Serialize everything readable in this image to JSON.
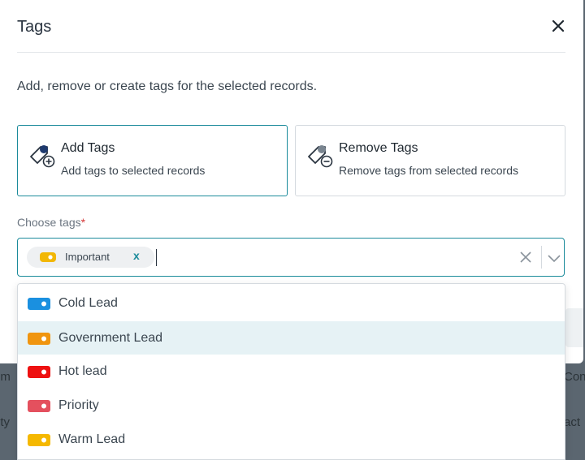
{
  "modal": {
    "title": "Tags",
    "description": "Add, remove or create tags for the selected records."
  },
  "options": {
    "add": {
      "title": "Add Tags",
      "subtitle": "Add tags to selected records"
    },
    "remove": {
      "title": "Remove Tags",
      "subtitle": "Remove tags from selected records"
    }
  },
  "field": {
    "label": "Choose tags",
    "required_mark": "*",
    "selected": [
      {
        "label": "Important",
        "color": "#f2b705",
        "remove": "x"
      }
    ]
  },
  "dropdown": {
    "items": [
      {
        "label": "Cold Lead",
        "color": "#1a90e0"
      },
      {
        "label": "Government Lead",
        "color": "#f0950f",
        "highlighted": true
      },
      {
        "label": "Hot lead",
        "color": "#ee1111"
      },
      {
        "label": "Priority",
        "color": "#e4505e"
      },
      {
        "label": "Warm Lead",
        "color": "#f5b800"
      }
    ]
  },
  "background": {
    "left_fragments": [
      "om",
      "rity"
    ],
    "right_fragments": [
      "Con",
      "act"
    ]
  },
  "colors": {
    "accent": "#1b8b9b"
  }
}
